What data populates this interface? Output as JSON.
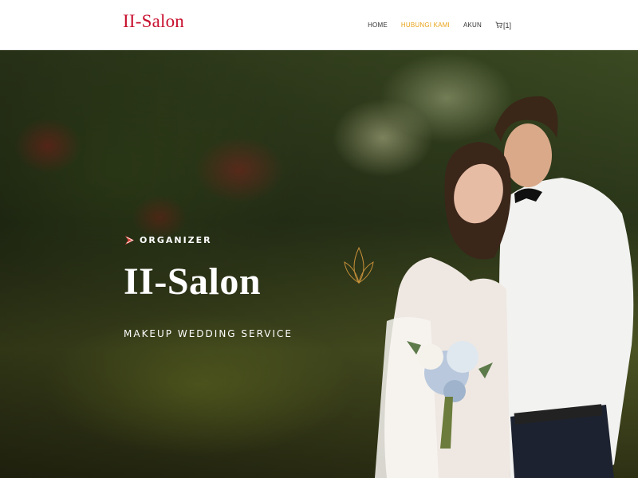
{
  "navbar": {
    "brand": "II-Salon",
    "links": [
      {
        "label": "HOME",
        "active": false
      },
      {
        "label": "HUBUNGI KAMI",
        "active": true
      },
      {
        "label": "AKUN",
        "active": false
      }
    ],
    "cart_count": "[1]",
    "cart_icon": "cart-icon"
  },
  "hero": {
    "eyebrow": "ORGANIZER",
    "eyebrow_icon": "logo-mark-icon",
    "title": "II-Salon",
    "subtitle": "MAKEUP WEDDING SERVICE",
    "decor_icon": "leaf-icon"
  },
  "colors": {
    "brand": "#c8102e",
    "nav_active": "#e8a317",
    "nav_text": "#333333",
    "hero_text": "#ffffff",
    "accent_icon": "#e0443a"
  }
}
